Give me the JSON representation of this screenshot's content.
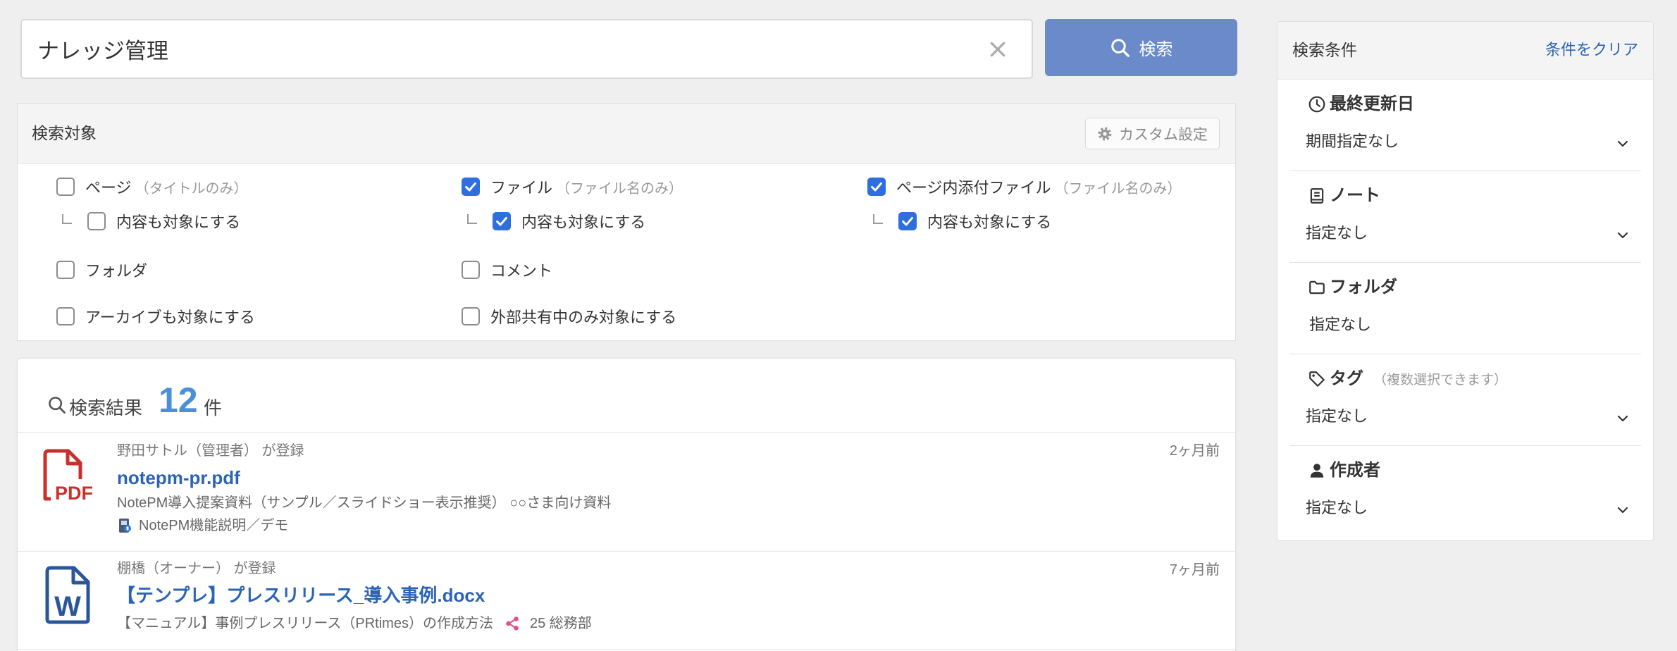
{
  "colors": {
    "accent": "#2f6fdd",
    "button": "#6b8ac9",
    "link": "#2b64b5",
    "count": "#4a90d9",
    "pdf": "#c9302c",
    "word": "#2b579a",
    "share": "#e0508a"
  },
  "search": {
    "query": "ナレッジ管理",
    "button_label": "検索",
    "button_icon": "search-icon",
    "clear_icon": "clear-icon"
  },
  "target": {
    "title": "検索対象",
    "custom_label": "カスタム設定",
    "custom_icon": "gear-icon",
    "types": [
      {
        "label": "ページ",
        "hint": "（タイトルのみ）",
        "checked": false,
        "sub_label": "内容も対象にする",
        "sub_checked": false
      },
      {
        "label": "ファイル",
        "hint": "（ファイル名のみ）",
        "checked": true,
        "sub_label": "内容も対象にする",
        "sub_checked": true
      },
      {
        "label": "ページ内添付ファイル",
        "hint": "（ファイル名のみ）",
        "checked": true,
        "sub_label": "内容も対象にする",
        "sub_checked": true
      }
    ],
    "extras": [
      {
        "label": "フォルダ",
        "checked": false
      },
      {
        "label": "コメント",
        "checked": false
      },
      {
        "label": "アーカイブも対象にする",
        "checked": false
      },
      {
        "label": "外部共有中のみ対象にする",
        "checked": false
      }
    ]
  },
  "results": {
    "label": "検索結果",
    "count": "12",
    "unit": "件",
    "items": [
      {
        "icon": "pdf-file-icon",
        "icon_text": "PDF",
        "registrant": "野田サトル（管理者） が登録",
        "time": "2ヶ月前",
        "title": "notepm-pr.pdf",
        "description": "NotePM導入提案資料（サンプル／スライドショー表示推奨） ○○さま向け資料",
        "note_icon": "note-icon",
        "note": "NotePM機能説明／デモ"
      },
      {
        "icon": "word-file-icon",
        "icon_text": "W",
        "registrant": "棚橋（オーナー） が登録",
        "time": "7ヶ月前",
        "title": "【テンプレ】プレスリリース_導入事例.docx",
        "description": "【マニュアル】事例プレスリリース（PRtimes）の作成方法",
        "note_icon": "share-icon",
        "note": "25 総務部"
      }
    ]
  },
  "filters": {
    "title": "検索条件",
    "clear_label": "条件をクリア",
    "sections": [
      {
        "icon": "clock-icon",
        "label": "最終更新日",
        "value": "期間指定なし"
      },
      {
        "icon": "notebook-icon",
        "label": "ノート",
        "value": "指定なし"
      },
      {
        "icon": "folder-icon",
        "label": "フォルダ",
        "value": "指定なし"
      },
      {
        "icon": "tag-icon",
        "label": "タグ",
        "hint": "（複数選択できます）",
        "value": "指定なし"
      },
      {
        "icon": "person-icon",
        "label": "作成者",
        "value": "指定なし"
      }
    ]
  }
}
